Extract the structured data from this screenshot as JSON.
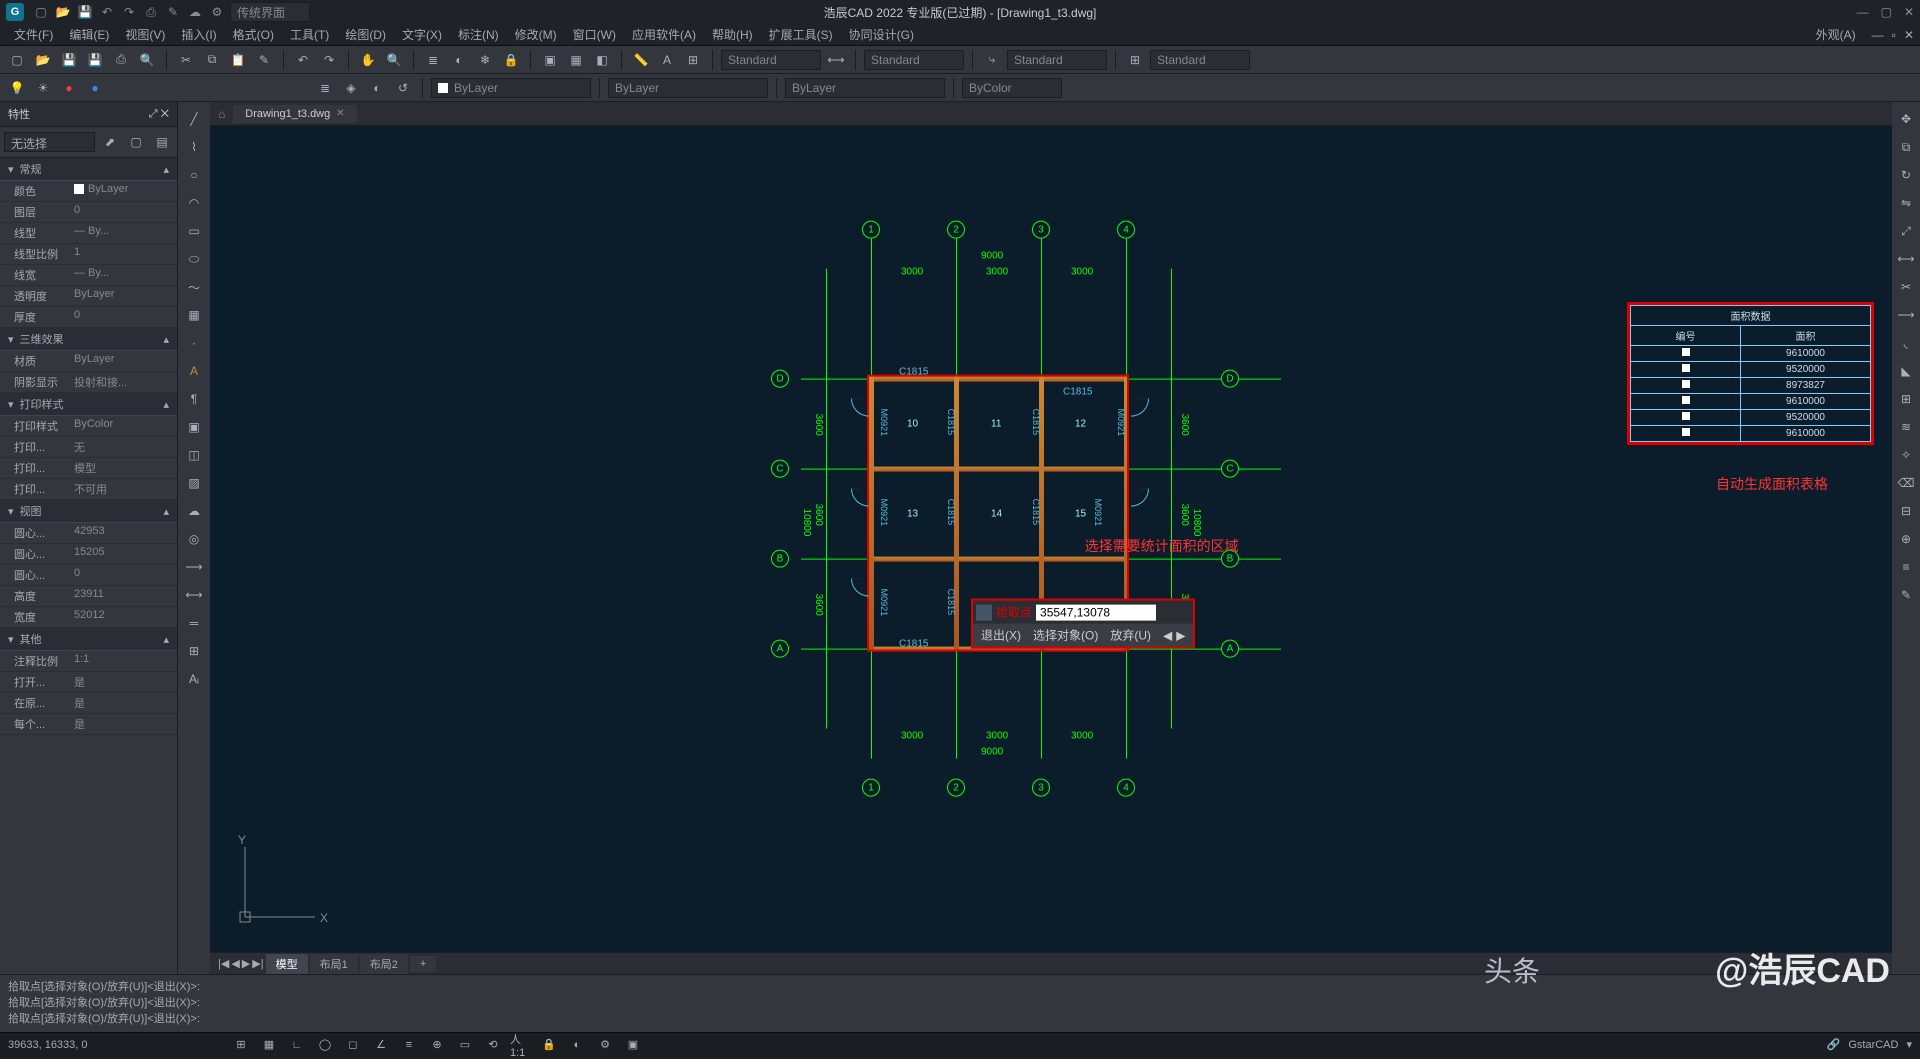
{
  "title": "浩辰CAD 2022 专业版(已过期) - [Drawing1_t3.dwg]",
  "workspace": "传统界面",
  "menus": [
    "文件(F)",
    "编辑(E)",
    "视图(V)",
    "插入(I)",
    "格式(O)",
    "工具(T)",
    "绘图(D)",
    "文字(X)",
    "标注(N)",
    "修改(M)",
    "窗口(W)",
    "应用软件(A)",
    "帮助(H)",
    "扩展工具(S)",
    "协同设计(G)"
  ],
  "menu_right": "外观(A)",
  "file_tab": "Drawing1_t3.dwg",
  "layer_dropdown": "ByLayer",
  "style_dropdowns": [
    "ByLayer",
    "ByLayer",
    "ByColor",
    "Standard",
    "Standard",
    "Standard",
    "Standard"
  ],
  "props": {
    "title": "特性",
    "selector": "无选择",
    "sections": {
      "general": {
        "title": "常规",
        "rows": [
          {
            "k": "颜色",
            "v": "ByLayer",
            "swatch": true
          },
          {
            "k": "图层",
            "v": "0"
          },
          {
            "k": "线型",
            "v": "— By..."
          },
          {
            "k": "线型比例",
            "v": "1"
          },
          {
            "k": "线宽",
            "v": "— By..."
          },
          {
            "k": "透明度",
            "v": "ByLayer"
          },
          {
            "k": "厚度",
            "v": "0"
          }
        ]
      },
      "fx3d": {
        "title": "三维效果",
        "rows": [
          {
            "k": "材质",
            "v": "ByLayer"
          },
          {
            "k": "阴影显示",
            "v": "投射和接..."
          }
        ]
      },
      "plotstyle": {
        "title": "打印样式",
        "rows": [
          {
            "k": "打印样式",
            "v": "ByColor"
          },
          {
            "k": "打印...",
            "v": "无"
          },
          {
            "k": "打印...",
            "v": "模型"
          },
          {
            "k": "打印...",
            "v": "不可用"
          }
        ]
      },
      "view": {
        "title": "视图",
        "rows": [
          {
            "k": "圆心...",
            "v": "42953"
          },
          {
            "k": "圆心...",
            "v": "15205"
          },
          {
            "k": "圆心...",
            "v": "0"
          },
          {
            "k": "高度",
            "v": "23911"
          },
          {
            "k": "宽度",
            "v": "52012"
          }
        ]
      },
      "other": {
        "title": "其他",
        "rows": [
          {
            "k": "注释比例",
            "v": "1:1"
          },
          {
            "k": "打开...",
            "v": "是"
          },
          {
            "k": "在原...",
            "v": "是"
          },
          {
            "k": "每个...",
            "v": "是"
          }
        ]
      }
    }
  },
  "dwg": {
    "cols": [
      "1",
      "2",
      "3",
      "4"
    ],
    "rows": [
      "D",
      "C",
      "B",
      "A"
    ],
    "top_total": "9000",
    "top_segs": [
      "3000",
      "3000",
      "3000"
    ],
    "side_total": "10800",
    "side_segs": [
      "3600",
      "3600",
      "3600"
    ],
    "rooms": [
      "10",
      "11",
      "12",
      "13",
      "14",
      "15"
    ],
    "door_codes": [
      "M0921",
      "C1815"
    ]
  },
  "tooltip": {
    "label": "拾取点",
    "value": "35547,13078",
    "opts": [
      "退出(X)",
      "选择对象(O)",
      "放弃(U)"
    ]
  },
  "annotations": {
    "region": "选择需要统计面积的区域",
    "table": "自动生成面积表格"
  },
  "area_table": {
    "title": "面积数据",
    "headers": [
      "编号",
      "面积"
    ],
    "rows": [
      [
        "",
        "9610000"
      ],
      [
        "",
        "9520000"
      ],
      [
        "",
        "8973827"
      ],
      [
        "",
        "9610000"
      ],
      [
        "",
        "9520000"
      ],
      [
        "",
        "9610000"
      ]
    ]
  },
  "layout_tabs": {
    "nav": [
      "|◀",
      "◀",
      "▶",
      "▶|"
    ],
    "tabs": [
      "模型",
      "布局1",
      "布局2"
    ],
    "active": 0
  },
  "cmd_history": [
    "拾取点[选择对象(O)/放弃(U)]<退出(X)>:",
    "拾取点[选择对象(O)/放弃(U)]<退出(X)>:",
    "拾取点[选择对象(O)/放弃(U)]<退出(X)>:"
  ],
  "status": {
    "coords": "39633, 16333, 0",
    "product": "GstarCAD"
  },
  "watermark": {
    "brand": "@浩辰CAD",
    "prefix": "头条"
  }
}
